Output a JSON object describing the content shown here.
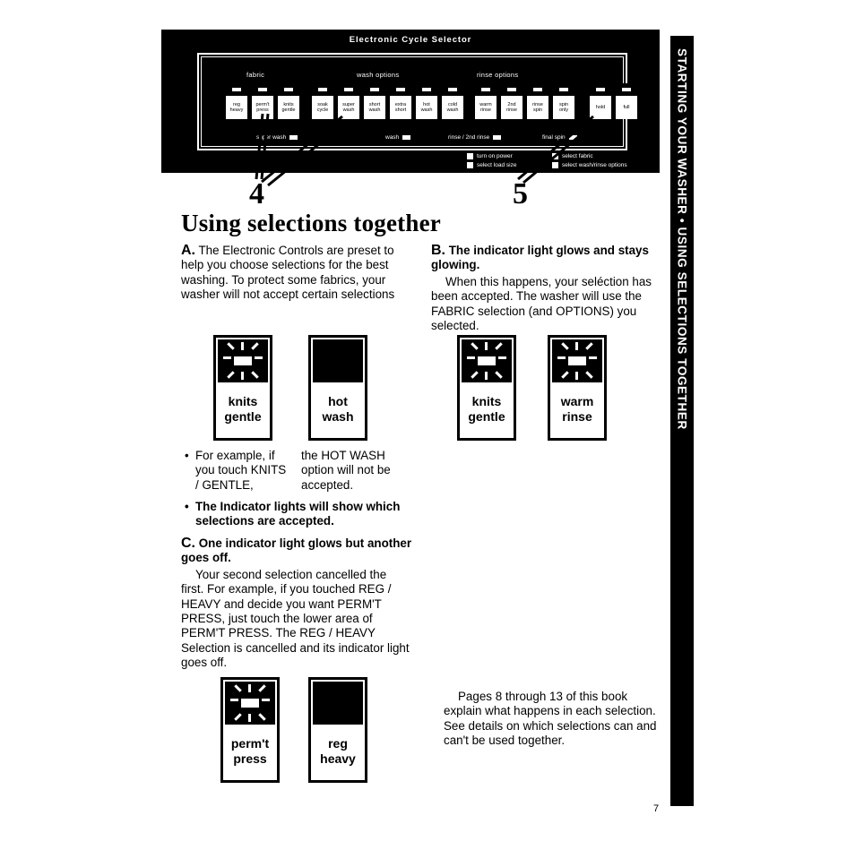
{
  "side_tab": {
    "text": "STARTING YOUR WASHER • USING SELECTIONS TOGETHER"
  },
  "panel": {
    "title": "Electronic Cycle Selector",
    "groups": [
      {
        "label": "fabric"
      },
      {
        "label": "wash options"
      },
      {
        "label": "rinse options"
      }
    ],
    "buttons": [
      {
        "line1": "reg",
        "line2": "heavy"
      },
      {
        "line1": "perm't",
        "line2": "press"
      },
      {
        "line1": "knits",
        "line2": "gentle"
      },
      {
        "line1": "soak",
        "line2": "cycle"
      },
      {
        "line1": "super",
        "line2": "wash"
      },
      {
        "line1": "short",
        "line2": "wash"
      },
      {
        "line1": "extra",
        "line2": "short"
      },
      {
        "line1": "hot",
        "line2": "wash"
      },
      {
        "line1": "cold",
        "line2": "wash"
      },
      {
        "line1": "warm",
        "line2": "rinse"
      },
      {
        "line1": "2nd",
        "line2": "rinse"
      },
      {
        "line1": "rinse",
        "line2": "spin"
      },
      {
        "line1": "spin",
        "line2": "only"
      },
      {
        "line1": "hold",
        "line2": ""
      },
      {
        "line1": "full",
        "line2": ""
      }
    ],
    "status": [
      {
        "label": "super wash"
      },
      {
        "label": "wash"
      },
      {
        "label": "rinse / 2nd rinse"
      },
      {
        "label": "final spin"
      }
    ],
    "legend": [
      {
        "label": "turn on power"
      },
      {
        "label": "select load size"
      },
      {
        "label": "select fabric"
      },
      {
        "label": "select wash/rinse options"
      }
    ]
  },
  "callouts": {
    "left": "4",
    "right": "5"
  },
  "heading": "Using selections together",
  "section_a": {
    "lead": "A.",
    "body": "The Electronic Controls are preset to help you choose selections for the best washing. To protect some fabrics, your washer will not accept certain selections"
  },
  "section_b": {
    "lead": "B.",
    "headline": "The indicator light glows and stays glowing.",
    "body": "When this happens, your seléction has been accepted. The washer will use the FABRIC selection (and OPTIONS) you selected."
  },
  "section_c": {
    "lead": "C.",
    "headline": "One indicator light glows but another goes off.",
    "body": "Your second selection cancelled the first. For example, if you touched REG / HEAVY and decide you want PERM'T PRESS, just touch the lower area of PERM'T PRESS. The REG / HEAVY Selection is cancelled and its indicator light goes off."
  },
  "example_bullet": {
    "left": "For example, if you touch KNITS / GENTLE,",
    "right": "the HOT WASH option will not be accepted."
  },
  "indicator_bullet": "The Indicator lights will show which selections are accepted.",
  "closing_note": "Pages 8 through 13 of this book explain what happens in each selection. See details on which selections can and can't be used together.",
  "buttons_a": [
    {
      "line1": "knits",
      "line2": "gentle",
      "lit": true
    },
    {
      "line1": "hot",
      "line2": "wash",
      "lit": false
    }
  ],
  "buttons_b": [
    {
      "line1": "knits",
      "line2": "gentle",
      "lit": true
    },
    {
      "line1": "warm",
      "line2": "rinse",
      "lit": true
    }
  ],
  "buttons_c": [
    {
      "line1": "perm't",
      "line2": "press",
      "lit": true
    },
    {
      "line1": "reg",
      "line2": "heavy",
      "lit": false
    }
  ],
  "page_number": "7"
}
